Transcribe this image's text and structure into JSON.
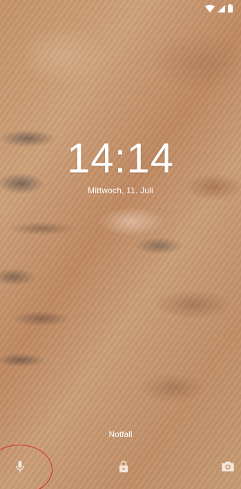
{
  "status_bar": {
    "icons": [
      "wifi-icon",
      "signal-icon",
      "battery-icon"
    ]
  },
  "lockscreen": {
    "time": "14:14",
    "date": "Mittwoch, 11. Juli",
    "emergency_label": "Notfall"
  },
  "bottom_bar": {
    "left_icon": "microphone-icon",
    "center_icon": "lock-icon",
    "right_icon": "camera-icon"
  },
  "annotation": {
    "highlight_color": "#d32626"
  }
}
